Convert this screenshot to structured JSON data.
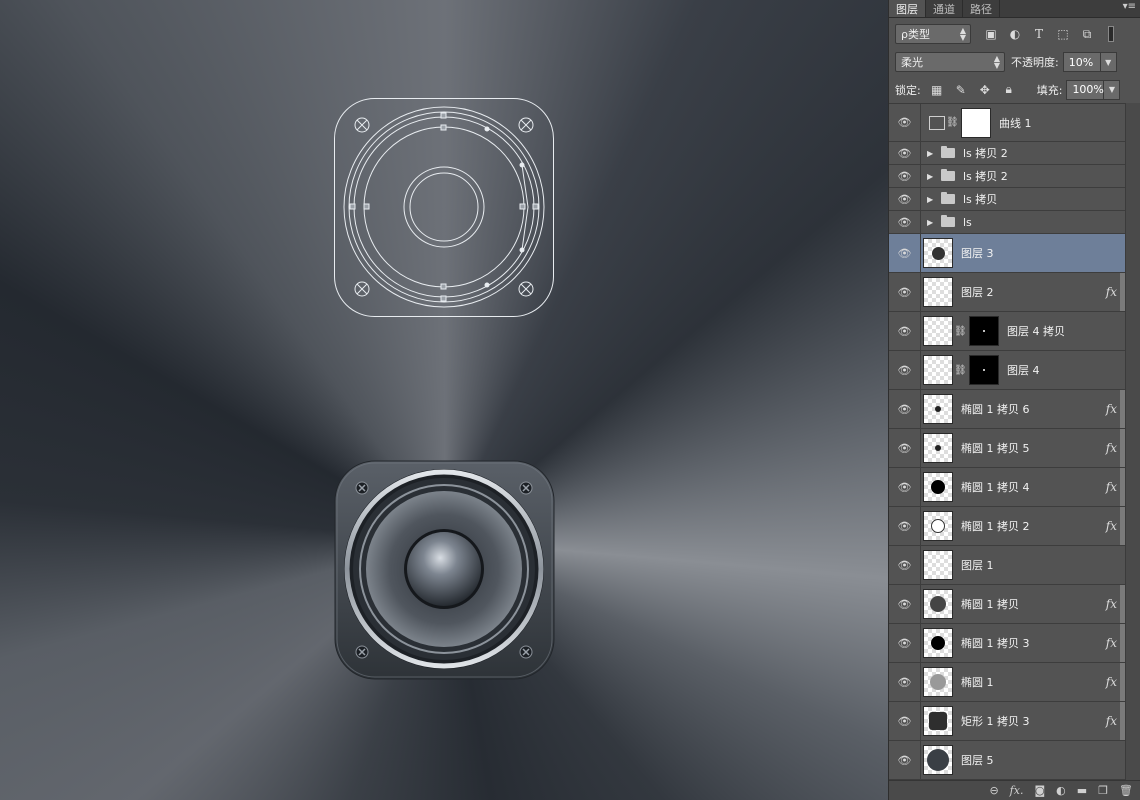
{
  "panel": {
    "tabs": [
      "图层",
      "通道",
      "路径"
    ],
    "menu_icon": "panel-menu-icon",
    "filter": {
      "value": "ρ类型"
    },
    "filter_icons": [
      "image-filter-icon",
      "adjustment-filter-icon",
      "type-filter-icon",
      "shape-filter-icon",
      "smart-object-filter-icon",
      "filter-toggle-icon"
    ],
    "blend_mode": "柔光",
    "opacity_label": "不透明度:",
    "opacity_value": "10%",
    "lock_label": "锁定:",
    "fill_label": "填充:",
    "fill_value": "100%"
  },
  "layers": [
    {
      "name": "曲线 1",
      "kind": "adjustment",
      "selected": false,
      "fx": false
    },
    {
      "name": "ls 拷贝 2",
      "kind": "group",
      "selected": false,
      "fx": false
    },
    {
      "name": "ls 拷贝 2",
      "kind": "group",
      "selected": false,
      "fx": false
    },
    {
      "name": "ls 拷贝",
      "kind": "group",
      "selected": false,
      "fx": false
    },
    {
      "name": "ls",
      "kind": "group",
      "selected": false,
      "fx": false
    },
    {
      "name": "图层 3",
      "kind": "pixel-dot",
      "selected": true,
      "fx": false
    },
    {
      "name": "图层 2",
      "kind": "pixel",
      "selected": false,
      "fx": true
    },
    {
      "name": "图层 4 拷贝",
      "kind": "masked",
      "selected": false,
      "fx": false
    },
    {
      "name": "图层 4",
      "kind": "masked",
      "selected": false,
      "fx": false
    },
    {
      "name": "椭圆 1 拷贝 6",
      "kind": "shape-small",
      "selected": false,
      "fx": true
    },
    {
      "name": "椭圆 1 拷贝 5",
      "kind": "shape-small",
      "selected": false,
      "fx": true
    },
    {
      "name": "椭圆 1 拷贝 4",
      "kind": "shape-black",
      "selected": false,
      "fx": true
    },
    {
      "name": "椭圆 1 拷贝 2",
      "kind": "shape-ring",
      "selected": false,
      "fx": true
    },
    {
      "name": "图层 1",
      "kind": "pixel",
      "selected": false,
      "fx": false
    },
    {
      "name": "椭圆 1 拷贝",
      "kind": "shape-dark",
      "selected": false,
      "fx": true
    },
    {
      "name": "椭圆 1 拷贝 3",
      "kind": "shape-black",
      "selected": false,
      "fx": true
    },
    {
      "name": "椭圆 1",
      "kind": "shape-grey",
      "selected": false,
      "fx": true
    },
    {
      "name": "矩形 1 拷贝 3",
      "kind": "shape-rect",
      "selected": false,
      "fx": true
    },
    {
      "name": "图层 5",
      "kind": "smart",
      "selected": false,
      "fx": false
    }
  ],
  "bottom_icons": [
    "link-layers-icon",
    "add-style-icon",
    "add-mask-icon",
    "adjustment-layer-icon",
    "new-group-icon",
    "new-layer-icon",
    "delete-layer-icon"
  ]
}
